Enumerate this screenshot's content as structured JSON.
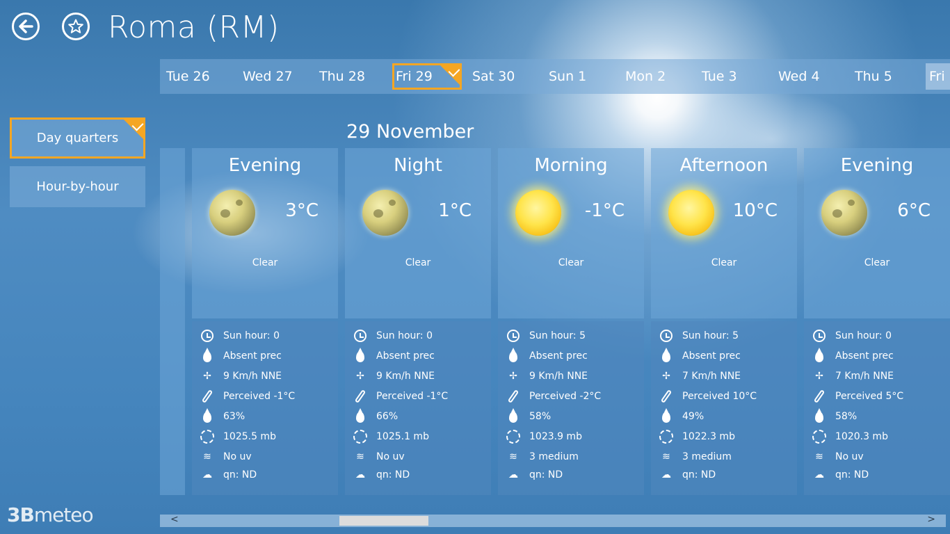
{
  "header": {
    "title": "Roma (RM)",
    "back_icon": "arrow-left-icon",
    "favorite_icon": "star-icon"
  },
  "colors": {
    "accent": "#f5a623",
    "tile": "#5a96cc"
  },
  "days": [
    "Tue 26",
    "Wed 27",
    "Thu 28",
    "Fri 29",
    "Sat 30",
    "Sun 1",
    "Mon 2",
    "Tue 3",
    "Wed 4",
    "Thu 5",
    "Fri"
  ],
  "selected_day": "Fri 29",
  "view_modes": {
    "day_quarters": "Day quarters",
    "hour_by_hour": "Hour-by-hour",
    "selected": "Day quarters"
  },
  "date_heading": "29 November",
  "quarters": [
    {
      "period": "Evening",
      "temp": "3°C",
      "icon": "moon-icon",
      "condition": "Clear",
      "sun_hours": "Sun hour: 0",
      "precip": "Absent prec",
      "wind": "9 Km/h NNE",
      "perceived": "Perceived -1°C",
      "humidity": "63%",
      "pressure": "1025.5 mb",
      "uv": "No uv",
      "qn": "qn: ND"
    },
    {
      "period": "Night",
      "temp": "1°C",
      "icon": "moon-icon",
      "condition": "Clear",
      "sun_hours": "Sun hour: 0",
      "precip": "Absent prec",
      "wind": "9 Km/h NNE",
      "perceived": "Perceived -1°C",
      "humidity": "66%",
      "pressure": "1025.1 mb",
      "uv": "No uv",
      "qn": "qn: ND"
    },
    {
      "period": "Morning",
      "temp": "-1°C",
      "icon": "sun-icon",
      "condition": "Clear",
      "sun_hours": "Sun hour: 5",
      "precip": "Absent prec",
      "wind": "9 Km/h NNE",
      "perceived": "Perceived -2°C",
      "humidity": "58%",
      "pressure": "1023.9 mb",
      "uv": "3 medium",
      "qn": "qn: ND"
    },
    {
      "period": "Afternoon",
      "temp": "10°C",
      "icon": "sun-icon",
      "condition": "Clear",
      "sun_hours": "Sun hour: 5",
      "precip": "Absent prec",
      "wind": "7 Km/h NNE",
      "perceived": "Perceived 10°C",
      "humidity": "49%",
      "pressure": "1022.3 mb",
      "uv": "3 medium",
      "qn": "qn: ND"
    },
    {
      "period": "Evening",
      "temp": "6°C",
      "icon": "moon-icon",
      "condition": "Clear",
      "sun_hours": "Sun hour: 0",
      "precip": "Absent prec",
      "wind": "7 Km/h NNE",
      "perceived": "Perceived 5°C",
      "humidity": "58%",
      "pressure": "1020.3 mb",
      "uv": "No uv",
      "qn": "qn: ND"
    }
  ],
  "scrollbar": {
    "left_arrow": "<",
    "right_arrow": ">",
    "position_percent": 23
  },
  "logo": {
    "prefix": "3B",
    "suffix": "meteo"
  }
}
